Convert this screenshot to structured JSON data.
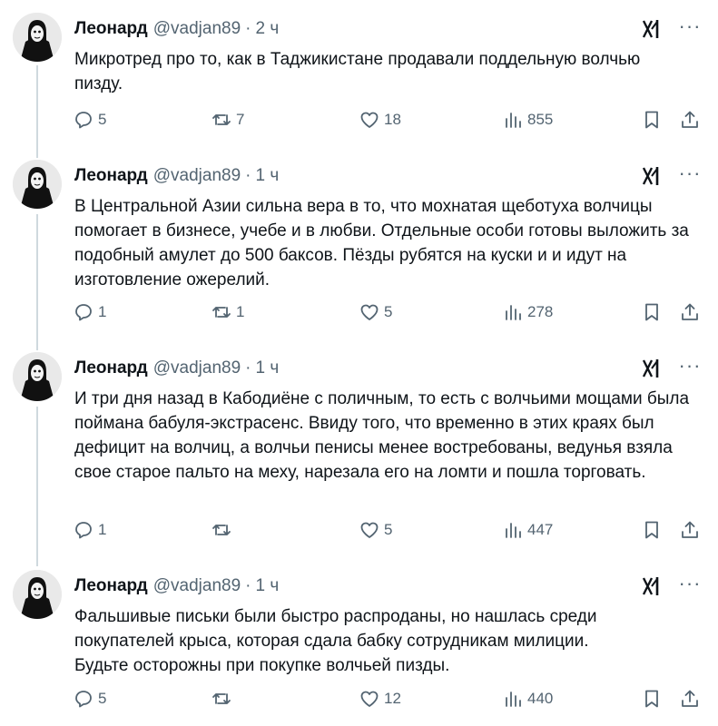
{
  "tweets": [
    {
      "name": "Леонард",
      "handle": "@vadjan89",
      "separator": "·",
      "time": "2 ч",
      "text": "Микротред про то, как в Таджикистане продавали поддельную волчью пизду.",
      "replies": "5",
      "retweets": "7",
      "likes": "18",
      "views": "855"
    },
    {
      "name": "Леонард",
      "handle": "@vadjan89",
      "separator": "·",
      "time": "1 ч",
      "text": "В Центральной Азии сильна вера в то, что мохнатая щеботуха волчицы помогает в бизнесе, учебе и в любви. Отдельные особи готовы выложить за подобный амулет до 500 баксов. Пёзды рубятся на куски и и идут на изготовление ожерелий.",
      "replies": "1",
      "retweets": "1",
      "likes": "5",
      "views": "278"
    },
    {
      "name": "Леонард",
      "handle": "@vadjan89",
      "separator": "·",
      "time": "1 ч",
      "text": "И три дня назад в Кабодиёне с поличным, то есть с волчьими мощами была поймана бабуля-экстрасенс. Ввиду того, что временно в этих краях был дефицит на волчиц, а волчьи пенисы менее востребованы, ведунья взяла свое старое пальто на меху, нарезала его на ломти и пошла торговать.",
      "replies": "1",
      "retweets": "",
      "likes": "5",
      "views": "447"
    },
    {
      "name": "Леонард",
      "handle": "@vadjan89",
      "separator": "·",
      "time": "1 ч",
      "text": "Фальшивые письки были быстро распроданы, но нашлась среди покупателей крыса, которая сдала бабку сотрудникам милиции.\nБудьте осторожны при покупке волчьей пизды.",
      "replies": "5",
      "retweets": "",
      "likes": "12",
      "views": "440"
    }
  ],
  "icons": {
    "grok": "grok-icon",
    "more": "more-icon",
    "reply": "reply-icon",
    "retweet": "retweet-icon",
    "like": "like-icon",
    "views": "views-icon",
    "bookmark": "bookmark-icon",
    "share": "share-icon"
  },
  "more_glyph": "···",
  "colors": {
    "text": "#0f1419",
    "muted": "#536471",
    "thread_line": "#cfd9de"
  }
}
